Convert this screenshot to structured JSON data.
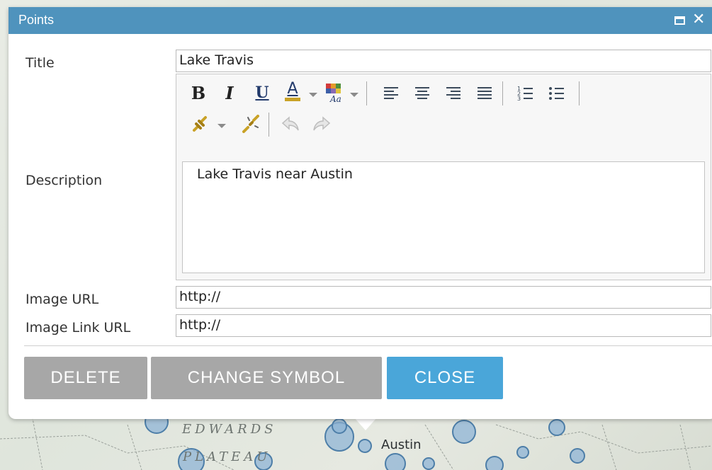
{
  "dialog": {
    "title": "Points",
    "maximize_icon": "maximize-icon",
    "close_icon": "close-icon"
  },
  "form": {
    "title_label": "Title",
    "title_value": "Lake Travis",
    "description_label": "Description",
    "description_value": "Lake Travis near Austin",
    "image_url_label": "Image URL",
    "image_url_value": "http://",
    "image_link_url_label": "Image Link URL",
    "image_link_url_value": "http://"
  },
  "toolbar": {
    "bold": "B",
    "italic": "I",
    "underline": "U",
    "font_color": "A",
    "icons": [
      "bold-icon",
      "italic-icon",
      "underline-icon",
      "font-color-icon",
      "highlight-color-icon",
      "align-left-icon",
      "align-center-icon",
      "align-right-icon",
      "justify-icon",
      "numbered-list-icon",
      "bullet-list-icon",
      "link-icon",
      "unlink-icon",
      "undo-icon",
      "redo-icon"
    ]
  },
  "buttons": {
    "delete": "DELETE",
    "change_symbol": "CHANGE SYMBOL",
    "close": "CLOSE",
    "delete_color": "#a7a7a7",
    "close_color": "#4aa6d9"
  },
  "map": {
    "labels": [
      "EDWARDS",
      "PLATEAU"
    ],
    "city": "Austin"
  }
}
